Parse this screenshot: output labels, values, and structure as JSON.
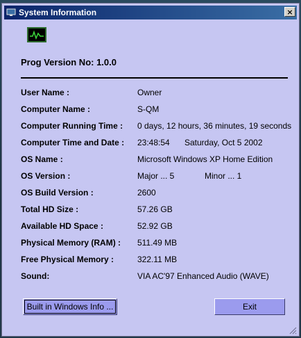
{
  "window": {
    "title": "System Information",
    "close_label": "×"
  },
  "icons": {
    "title": "monitor-icon",
    "app": "waveform-monitor-icon"
  },
  "version": "Prog Version No: 1.0.0",
  "info": {
    "user_name": {
      "label": "User Name :",
      "value": "Owner"
    },
    "computer_name": {
      "label": "Computer Name :",
      "value": "S-QM"
    },
    "running_time": {
      "label": "Computer Running Time :",
      "value": "0 days, 12 hours, 36 minutes, 19 seconds"
    },
    "time_date": {
      "label": "Computer Time and Date :",
      "time": "23:48:54",
      "date": "Saturday, Oct 5 2002"
    },
    "os_name": {
      "label": "OS Name :",
      "value": "Microsoft Windows XP Home Edition"
    },
    "os_version": {
      "label": "OS Version :",
      "major": "Major ... 5",
      "minor": "Minor ... 1"
    },
    "os_build": {
      "label": "OS Build Version :",
      "value": "2600"
    },
    "total_hd": {
      "label": "Total HD Size :",
      "value": "57.26 GB"
    },
    "available_hd": {
      "label": "Available HD Space :",
      "value": "52.92 GB"
    },
    "physical_memory": {
      "label": "Physical Memory (RAM) :",
      "value": "511.49 MB"
    },
    "free_memory": {
      "label": "Free Physical Memory :",
      "value": "322.11 MB"
    },
    "sound": {
      "label": "Sound:",
      "value": "VIA AC'97 Enhanced Audio (WAVE)"
    }
  },
  "buttons": {
    "builtin": "Built in Windows Info ...",
    "exit": "Exit"
  },
  "colors": {
    "window_bg": "#c6c6f2",
    "button_bg": "#9b9bee",
    "titlebar_start": "#0a246a",
    "titlebar_end": "#3a6ea5"
  }
}
